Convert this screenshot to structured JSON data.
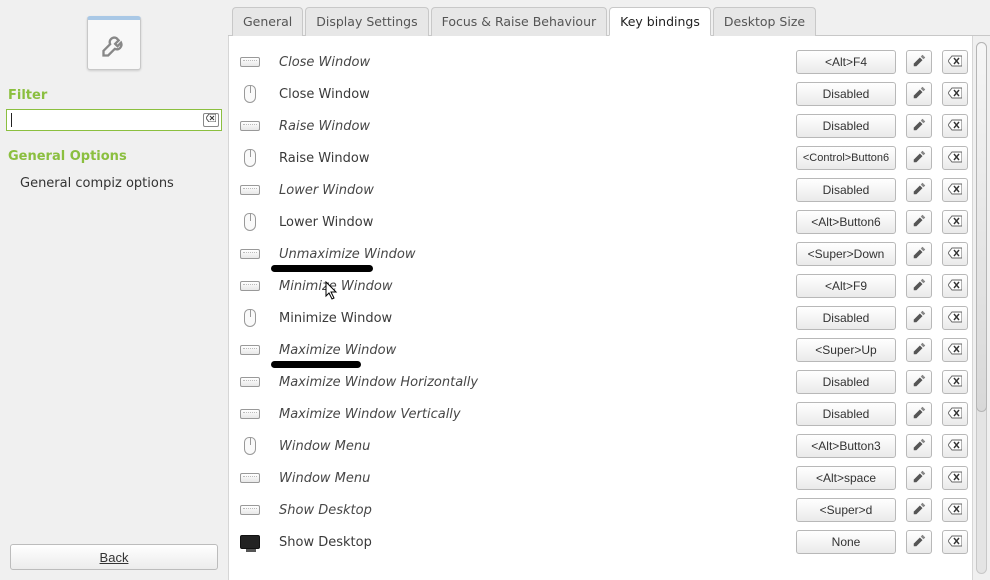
{
  "sidebar": {
    "filter_heading": "Filter",
    "filter_value": "",
    "filter_placeholder": "",
    "options_heading": "General Options",
    "items": [
      {
        "label": "General compiz options"
      }
    ],
    "back_label": "Back"
  },
  "tabs": [
    {
      "label": "General"
    },
    {
      "label": "Display Settings"
    },
    {
      "label": "Focus & Raise Behaviour"
    },
    {
      "label": "Key bindings"
    },
    {
      "label": "Desktop Size"
    }
  ],
  "active_tab": 3,
  "bindings": [
    {
      "icon": "keyboard",
      "label": "Close Window",
      "value": "<Alt>F4",
      "italic": true
    },
    {
      "icon": "mouse",
      "label": "Close Window",
      "value": "Disabled",
      "italic": false
    },
    {
      "icon": "keyboard",
      "label": "Raise Window",
      "value": "Disabled",
      "italic": true
    },
    {
      "icon": "mouse",
      "label": "Raise Window",
      "value": "<Control>Button6",
      "italic": false,
      "wide": true
    },
    {
      "icon": "keyboard",
      "label": "Lower Window",
      "value": "Disabled",
      "italic": true
    },
    {
      "icon": "mouse",
      "label": "Lower Window",
      "value": "<Alt>Button6",
      "italic": false
    },
    {
      "icon": "keyboard",
      "label": "Unmaximize Window",
      "value": "<Super>Down",
      "italic": true,
      "scribble_label": true,
      "scribble_value": true
    },
    {
      "icon": "keyboard",
      "label": "Minimize Window",
      "value": "<Alt>F9",
      "italic": true,
      "cursor": true
    },
    {
      "icon": "mouse",
      "label": "Minimize Window",
      "value": "Disabled",
      "italic": false
    },
    {
      "icon": "keyboard",
      "label": "Maximize Window",
      "value": "<Super>Up",
      "italic": true,
      "scribble_label": true,
      "scribble_value": true
    },
    {
      "icon": "keyboard",
      "label": "Maximize Window Horizontally",
      "value": "Disabled",
      "italic": true
    },
    {
      "icon": "keyboard",
      "label": "Maximize Window Vertically",
      "value": "Disabled",
      "italic": true
    },
    {
      "icon": "mouse",
      "label": "Window Menu",
      "value": "<Alt>Button3",
      "italic": true
    },
    {
      "icon": "keyboard",
      "label": "Window Menu",
      "value": "<Alt>space",
      "italic": true
    },
    {
      "icon": "keyboard",
      "label": "Show Desktop",
      "value": "<Super>d",
      "italic": true
    },
    {
      "icon": "monitor",
      "label": "Show Desktop",
      "value": "None",
      "italic": false
    }
  ]
}
